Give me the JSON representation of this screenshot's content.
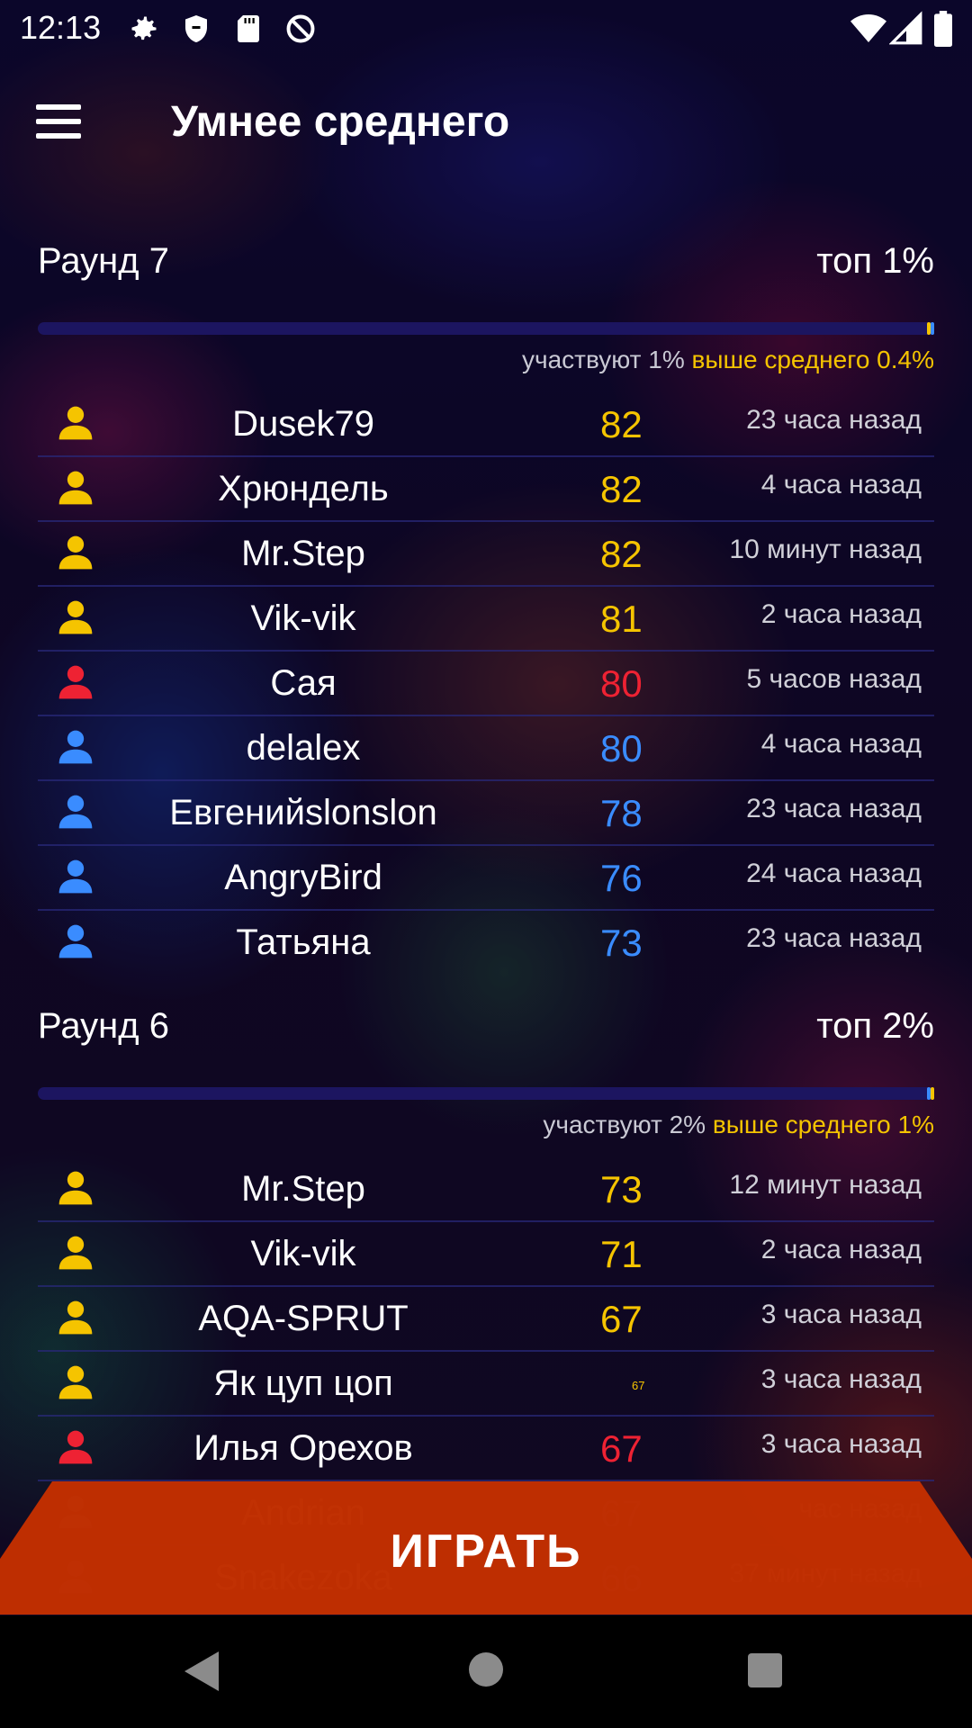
{
  "status_bar": {
    "time": "12:13",
    "icons": [
      "gear-icon",
      "shield-icon",
      "sd-card-icon",
      "no-sync-icon"
    ],
    "right_icons": [
      "wifi-icon",
      "signal-icon",
      "battery-icon"
    ]
  },
  "app_bar": {
    "title": "Умнее среднего",
    "menu_icon": "hamburger-menu-icon"
  },
  "colors": {
    "gold": "#f5c400",
    "red": "#ee2233",
    "blue": "#3a8cff",
    "play_button": "#c42f00",
    "progress_track": "#1c1560"
  },
  "rounds": [
    {
      "name": "Раунд 7",
      "top": "топ 1%",
      "participate_label": "участвуют 1%",
      "above_label": "выше среднего 0.4%",
      "progress_marks": [
        "gold",
        "blue"
      ],
      "players": [
        {
          "name": "Dusek79",
          "score": "82",
          "ago": "23 часа назад",
          "color": "gold"
        },
        {
          "name": "Хрюндель",
          "score": "82",
          "ago": "4 часа назад",
          "color": "gold"
        },
        {
          "name": "Mr.Step",
          "score": "82",
          "ago": "10 минут назад",
          "color": "gold"
        },
        {
          "name": "Vik-vik",
          "score": "81",
          "ago": "2 часа назад",
          "color": "gold"
        },
        {
          "name": "Сая",
          "score": "80",
          "ago": "5 часов назад",
          "color": "red"
        },
        {
          "name": "delalex",
          "score": "80",
          "ago": "4 часа назад",
          "color": "blue"
        },
        {
          "name": "Евгенийslonslon",
          "score": "78",
          "ago": "23 часа назад",
          "color": "blue"
        },
        {
          "name": "AngryBird",
          "score": "76",
          "ago": "24 часа назад",
          "color": "blue"
        },
        {
          "name": "Татьяна",
          "score": "73",
          "ago": "23 часа назад",
          "color": "blue"
        }
      ]
    },
    {
      "name": "Раунд 6",
      "top": "топ 2%",
      "participate_label": "участвуют 2%",
      "above_label": "выше среднего 1%",
      "progress_marks": [
        "blue",
        "gold"
      ],
      "players": [
        {
          "name": "Mr.Step",
          "score": "73",
          "ago": "12 минут назад",
          "color": "gold"
        },
        {
          "name": "Vik-vik",
          "score": "71",
          "ago": "2 часа назад",
          "color": "gold"
        },
        {
          "name": "AQA-SPRUT",
          "score": "67",
          "ago": "3 часа назад",
          "color": "gold"
        },
        {
          "name": "Як цуп цоп",
          "score": "67",
          "ago": "3 часа назад",
          "color": "gold"
        },
        {
          "name": "Илья Орехов",
          "score": "67",
          "ago": "3 часа назад",
          "color": "red"
        },
        {
          "name": "Andrian",
          "score": "67",
          "ago": "час назад",
          "color": "blue"
        },
        {
          "name": "Snakezoka",
          "score": "66",
          "ago": "37 минут назад",
          "color": "blue"
        }
      ]
    }
  ],
  "play_button": {
    "label": "ИГРАТЬ"
  },
  "nav_bar": {
    "back": "back-triangle-icon",
    "home": "home-circle-icon",
    "recents": "recents-square-icon"
  }
}
